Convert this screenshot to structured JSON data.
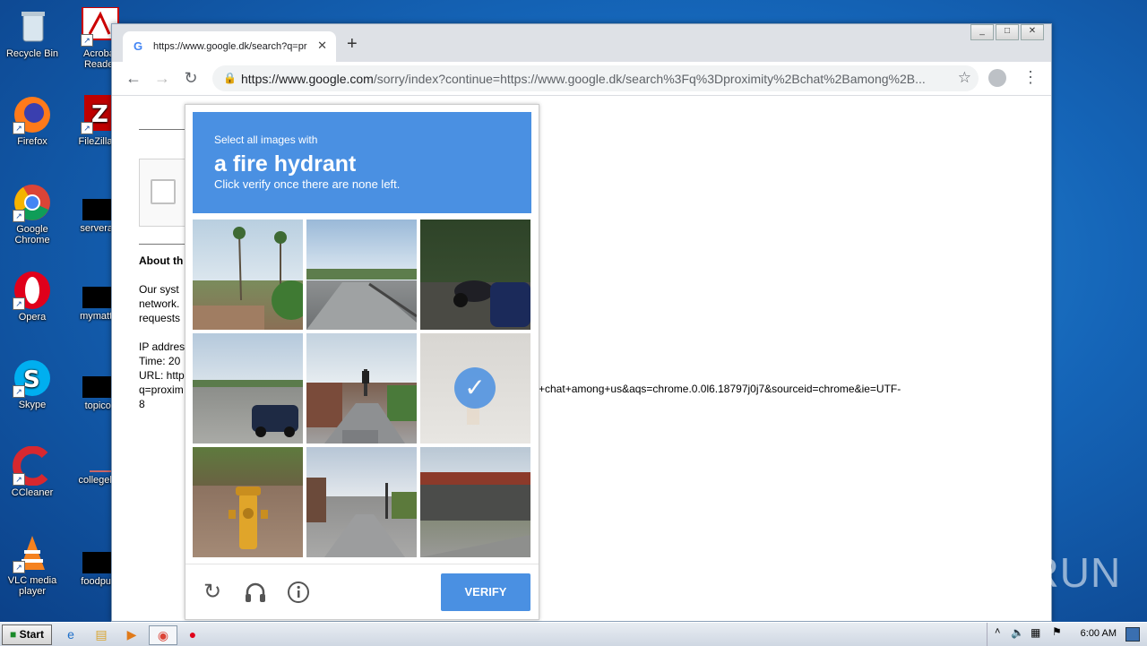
{
  "desktop": {
    "icons": [
      {
        "label": "Recycle Bin"
      },
      {
        "label": "Acrobat Reader"
      },
      {
        "label": "Firefox"
      },
      {
        "label": "FileZilla C"
      },
      {
        "label": "Google Chrome"
      },
      {
        "label": "serveradi"
      },
      {
        "label": "Opera"
      },
      {
        "label": "mymatter"
      },
      {
        "label": "Skype"
      },
      {
        "label": "topico.j"
      },
      {
        "label": "CCleaner"
      },
      {
        "label": "collegelite"
      },
      {
        "label": "VLC media player"
      },
      {
        "label": "foodpurp"
      }
    ]
  },
  "browser": {
    "tab_title": "https://www.google.dk/search?q=pr",
    "url_host": "https://www.google.com",
    "url_path": "/sorry/index?continue=https://www.google.dk/search%3Fq%3Dproximity%2Bchat%2Bamong%2B...",
    "window_buttons": [
      "_",
      "□",
      "✕"
    ]
  },
  "page": {
    "about_heading": "About th",
    "para_lines": [
      "Our syst",
      "network.",
      "requests"
    ],
    "ip_lines": [
      "IP addres",
      "Time: 20",
      "URL: http",
      "q=proxim",
      "8"
    ],
    "url_tail": "+chat+among+us&aqs=chrome.0.0l6.18797j0j7&sourceid=chrome&ie=UTF-"
  },
  "captcha": {
    "instruction_small": "Select all images with",
    "instruction_target": "a fire hydrant",
    "instruction_hint": "Click verify once there are none left.",
    "tiles": [
      {
        "name": "palm-trees",
        "selected": false
      },
      {
        "name": "bridge-road",
        "selected": false
      },
      {
        "name": "motorcycle-car",
        "selected": false
      },
      {
        "name": "highway-car",
        "selected": false
      },
      {
        "name": "street-traffic-light",
        "selected": false
      },
      {
        "name": "faded-hydrant",
        "selected": true
      },
      {
        "name": "yellow-hydrant",
        "selected": false
      },
      {
        "name": "town-street",
        "selected": false
      },
      {
        "name": "overpass",
        "selected": false
      }
    ],
    "verify_label": "VERIFY"
  },
  "watermark": "ANY RUN",
  "taskbar": {
    "start_label": "Start",
    "clock": "6:00 AM"
  }
}
